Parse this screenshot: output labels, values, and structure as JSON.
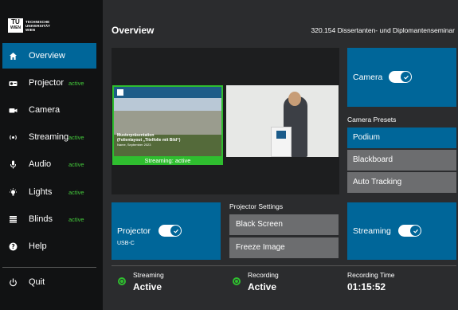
{
  "logo": {
    "mark": "TU",
    "mark2": "WIEN",
    "lines": [
      "TECHNISCHE",
      "UNIVERSITÄT",
      "WIEN"
    ]
  },
  "sidebar": {
    "items": [
      {
        "label": "Overview",
        "badge": "",
        "icon": "home-icon"
      },
      {
        "label": "Projector",
        "badge": "active",
        "icon": "projector-icon"
      },
      {
        "label": "Camera",
        "badge": "",
        "icon": "video-camera-icon"
      },
      {
        "label": "Streaming",
        "badge": "active",
        "icon": "streaming-icon"
      },
      {
        "label": "Audio",
        "badge": "active",
        "icon": "microphone-icon"
      },
      {
        "label": "Lights",
        "badge": "active",
        "icon": "light-bulb-icon"
      },
      {
        "label": "Blinds",
        "badge": "active",
        "icon": "blinds-icon"
      },
      {
        "label": "Help",
        "badge": "",
        "icon": "help-icon"
      }
    ],
    "quit_label": "Quit"
  },
  "header": {
    "title": "Overview",
    "course": "320.154 Dissertanten- und Diplomantenseminar"
  },
  "preview": {
    "slide_title": "Musterpräsentation",
    "slide_subtitle": "(Folienlayout „Titelfolie mit Bild“)",
    "slide_meta": "Name, September 2023",
    "slide_status": "Streaming: active"
  },
  "camera": {
    "label": "Camera",
    "on": true
  },
  "presets": {
    "heading": "Camera Presets",
    "items": [
      {
        "label": "Podium",
        "selected": true
      },
      {
        "label": "Blackboard",
        "selected": false
      },
      {
        "label": "Auto Tracking",
        "selected": false
      }
    ]
  },
  "projector": {
    "label": "Projector",
    "source": "USB-C",
    "on": true
  },
  "projector_settings": {
    "heading": "Projector Settings",
    "buttons": [
      "Black Screen",
      "Freeze Image"
    ]
  },
  "streaming_panel": {
    "label": "Streaming",
    "on": true
  },
  "status": {
    "streaming": {
      "label": "Streaming",
      "value": "Active"
    },
    "recording": {
      "label": "Recording",
      "value": "Active"
    },
    "recording_time": {
      "label": "Recording Time",
      "value": "01:15:52"
    }
  },
  "colors": {
    "accent": "#006699",
    "active": "#2fbe2f",
    "sidebar": "#111213",
    "background": "#2b2c2e",
    "button": "#6c6d6f"
  }
}
